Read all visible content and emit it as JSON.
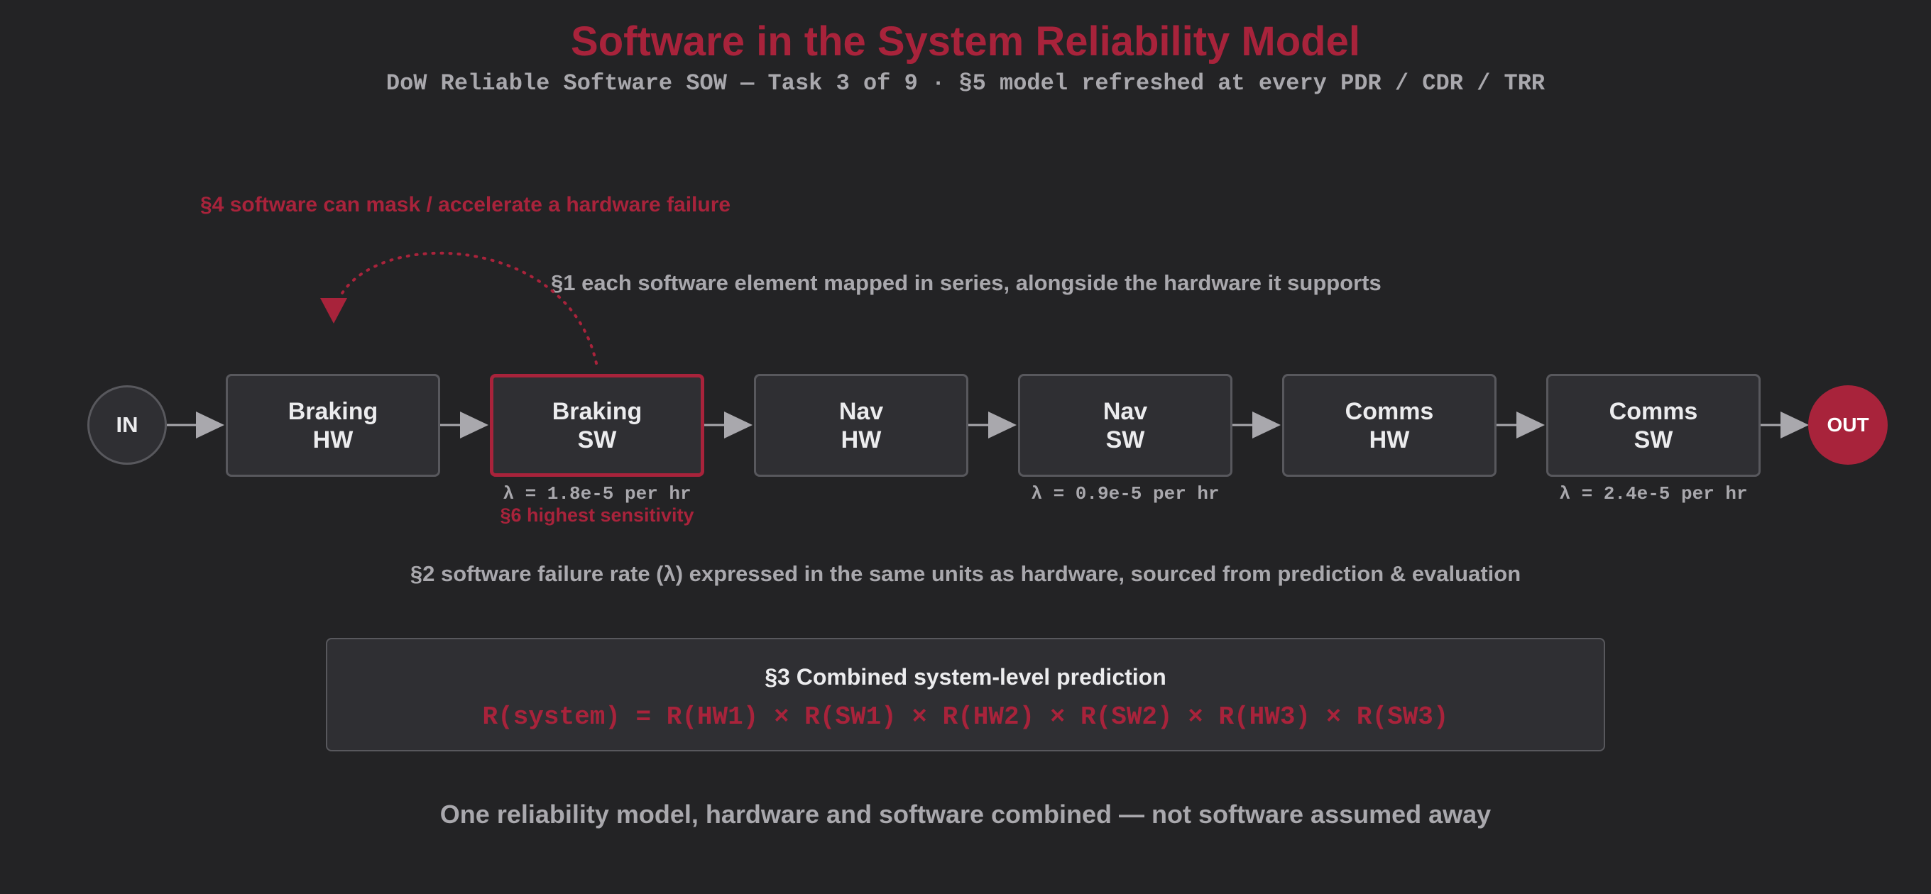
{
  "title": "Software in the System Reliability Model",
  "subtitle": "DoW Reliable Software SOW — Task 3 of 9 · §5 model refreshed at every PDR / CDR / TRR",
  "colors": {
    "background": "#232325",
    "accent": "#a8233b",
    "text_muted": "#a9a8ad",
    "box_fill": "#2f2f33",
    "box_border": "#58585d"
  },
  "notes": {
    "mask_note": "§4 software can mask / accelerate a hardware failure",
    "series_note": "§1 each software element mapped in series, alongside the hardware it supports",
    "units_note": "§2 software failure rate (λ) expressed in the same units as hardware, sourced from prediction & evaluation"
  },
  "chain": {
    "input_label": "IN",
    "output_label": "OUT",
    "nodes": [
      {
        "line1": "Braking",
        "line2": "HW"
      },
      {
        "line1": "Braking",
        "line2": "SW"
      },
      {
        "line1": "Nav",
        "line2": "HW"
      },
      {
        "line1": "Nav",
        "line2": "SW"
      },
      {
        "line1": "Comms",
        "line2": "HW"
      },
      {
        "line1": "Comms",
        "line2": "SW"
      }
    ],
    "rates": {
      "braking_sw": "λ = 1.8e-5 per hr",
      "nav_sw": "λ = 0.9e-5 per hr",
      "comms_sw": "λ = 2.4e-5 per hr"
    },
    "sensitivity_note": "§6 highest sensitivity"
  },
  "prediction": {
    "title": "§3 Combined system-level prediction",
    "formula": "R(system) = R(HW1) × R(SW1) × R(HW2) × R(SW2) × R(HW3) × R(SW3)"
  },
  "footer": "One reliability model, hardware and software combined — not software assumed away"
}
